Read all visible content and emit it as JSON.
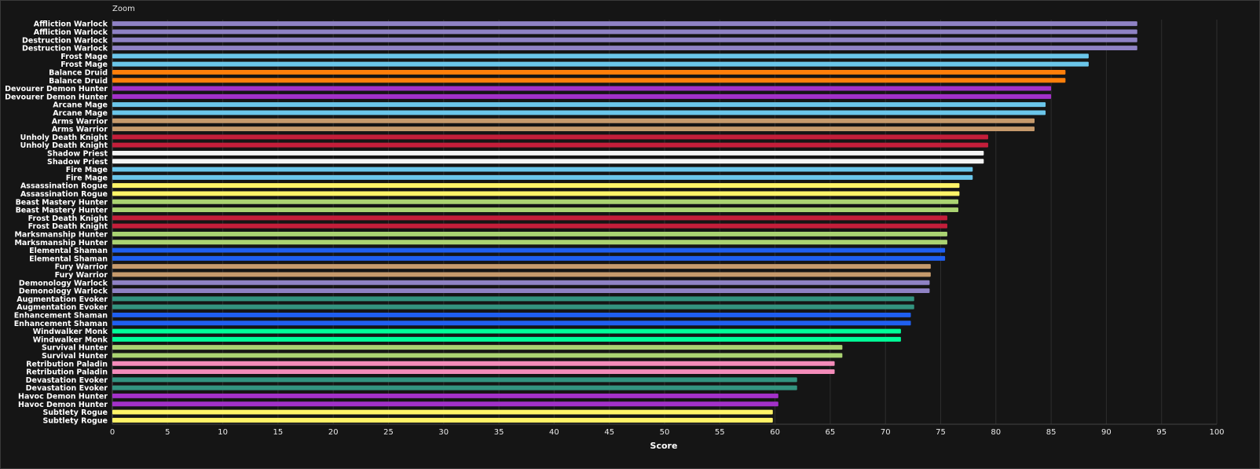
{
  "zoom_label": "Zoom",
  "chart_data": {
    "type": "bar",
    "orientation": "horizontal",
    "xlabel": "Score",
    "ylabel": "",
    "xlim": [
      0,
      100
    ],
    "xticks": [
      0,
      5,
      10,
      15,
      20,
      25,
      30,
      35,
      40,
      45,
      50,
      55,
      60,
      65,
      70,
      75,
      80,
      85,
      90,
      95,
      100
    ],
    "grid": "vertical",
    "categories": [
      "Affliction Warlock",
      "Affliction Warlock",
      "Destruction Warlock",
      "Destruction Warlock",
      "Frost Mage",
      "Frost Mage",
      "Balance Druid",
      "Balance Druid",
      "Devourer Demon Hunter",
      "Devourer Demon Hunter",
      "Arcane Mage",
      "Arcane Mage",
      "Arms Warrior",
      "Arms Warrior",
      "Unholy Death Knight",
      "Unholy Death Knight",
      "Shadow Priest",
      "Shadow Priest",
      "Fire Mage",
      "Fire Mage",
      "Assassination Rogue",
      "Assassination Rogue",
      "Beast Mastery Hunter",
      "Beast Mastery Hunter",
      "Frost Death Knight",
      "Frost Death Knight",
      "Marksmanship Hunter",
      "Marksmanship Hunter",
      "Elemental Shaman",
      "Elemental Shaman",
      "Fury Warrior",
      "Fury Warrior",
      "Demonology Warlock",
      "Demonology Warlock",
      "Augmentation Evoker",
      "Augmentation Evoker",
      "Enhancement Shaman",
      "Enhancement Shaman",
      "Windwalker Monk",
      "Windwalker Monk",
      "Survival Hunter",
      "Survival Hunter",
      "Retribution Paladin",
      "Retribution Paladin",
      "Devastation Evoker",
      "Devastation Evoker",
      "Havoc Demon Hunter",
      "Havoc Demon Hunter",
      "Subtlety Rogue",
      "Subtlety Rogue"
    ],
    "values": [
      92.8,
      92.8,
      92.8,
      92.8,
      88.4,
      88.4,
      86.3,
      86.3,
      85.0,
      85.0,
      84.5,
      84.5,
      83.5,
      83.5,
      79.3,
      79.3,
      78.9,
      78.9,
      77.9,
      77.9,
      76.7,
      76.7,
      76.6,
      76.6,
      75.6,
      75.6,
      75.6,
      75.6,
      75.4,
      75.4,
      74.1,
      74.1,
      74.0,
      74.0,
      72.6,
      72.6,
      72.3,
      72.3,
      71.4,
      71.4,
      66.1,
      66.1,
      65.4,
      65.4,
      62.0,
      62.0,
      60.3,
      60.3,
      59.8,
      59.8
    ],
    "colors": [
      "#8f82c4",
      "#8f82c4",
      "#8f82c4",
      "#8f82c4",
      "#6bc6ea",
      "#6bc6ea",
      "#ff7f0a",
      "#ff7f0a",
      "#a331c9",
      "#a331c9",
      "#6bc6ea",
      "#6bc6ea",
      "#c69a6c",
      "#c69a6c",
      "#c41e3a",
      "#c41e3a",
      "#f5f5f5",
      "#f5f5f5",
      "#6bc6ea",
      "#6bc6ea",
      "#fff468",
      "#fff468",
      "#aad372",
      "#aad372",
      "#c41e3a",
      "#c41e3a",
      "#aad372",
      "#aad372",
      "#1f5ff0",
      "#1f5ff0",
      "#c69a6c",
      "#c69a6c",
      "#8f82c4",
      "#8f82c4",
      "#33937f",
      "#33937f",
      "#1f5ff0",
      "#1f5ff0",
      "#00ff98",
      "#00ff98",
      "#aad372",
      "#aad372",
      "#f48cba",
      "#f48cba",
      "#33937f",
      "#33937f",
      "#a331c9",
      "#a331c9",
      "#fff468",
      "#fff468"
    ]
  }
}
